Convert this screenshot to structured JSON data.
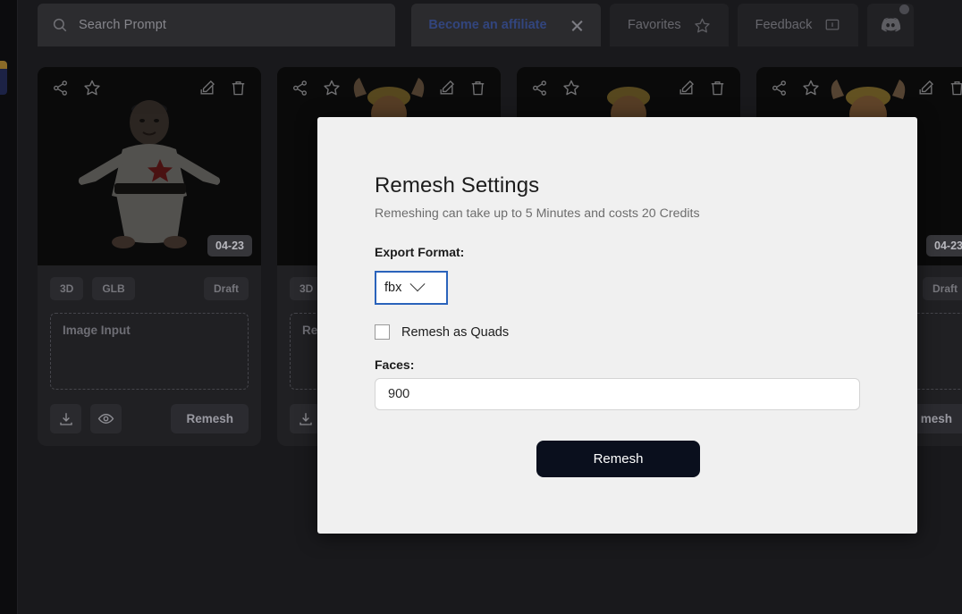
{
  "topbar": {
    "search": {
      "placeholder": "Search Prompt",
      "icon": "search-icon"
    },
    "affiliate": {
      "label": "Become an affiliate",
      "close_icon": "close-icon",
      "color": "#32457e"
    },
    "favorites": {
      "label": "Favorites",
      "icon": "star-icon"
    },
    "feedback": {
      "label": "Feedback",
      "icon": "speech-bubble-icon"
    },
    "discord": {
      "icon": "discord-icon",
      "has_notification": true
    }
  },
  "cards": [
    {
      "date": "04-23",
      "icons": [
        "share-icon",
        "star-icon",
        "edit-icon",
        "trash-icon"
      ],
      "tags": [
        "3D",
        "GLB"
      ],
      "status": "Draft",
      "dropzone_label": "Image Input",
      "action_icons": [
        "download-icon",
        "eye-icon"
      ],
      "remesh_label": "Remesh"
    },
    {
      "date": "",
      "icons": [
        "share-icon",
        "star-icon",
        "edit-icon",
        "trash-icon"
      ],
      "tags": [
        "3D"
      ],
      "status": "",
      "dropzone_label": "Re",
      "action_icons": [
        "download-icon"
      ],
      "remesh_label": ""
    },
    {
      "date": "",
      "icons": [
        "share-icon",
        "star-icon",
        "edit-icon",
        "trash-icon"
      ],
      "tags": [],
      "status": "",
      "dropzone_label": "",
      "action_icons": [],
      "remesh_label": ""
    },
    {
      "date": "04-23",
      "icons": [
        "share-icon",
        "star-icon",
        "edit-icon",
        "trash-icon"
      ],
      "tags": [],
      "status": "Draft",
      "dropzone_label": "",
      "action_icons": [],
      "remesh_label": "mesh"
    }
  ],
  "modal": {
    "title": "Remesh Settings",
    "subtitle": "Remeshing can take up to 5 Minutes and costs 20 Credits",
    "export_format_label": "Export Format:",
    "export_format_value": "fbx",
    "export_format_options": [
      "fbx"
    ],
    "quads_label": "Remesh as Quads",
    "quads_checked": false,
    "faces_label": "Faces:",
    "faces_value": "900",
    "submit_label": "Remesh",
    "submit_color": "#0a0f1d",
    "focus_border_color": "#2a63bb"
  }
}
